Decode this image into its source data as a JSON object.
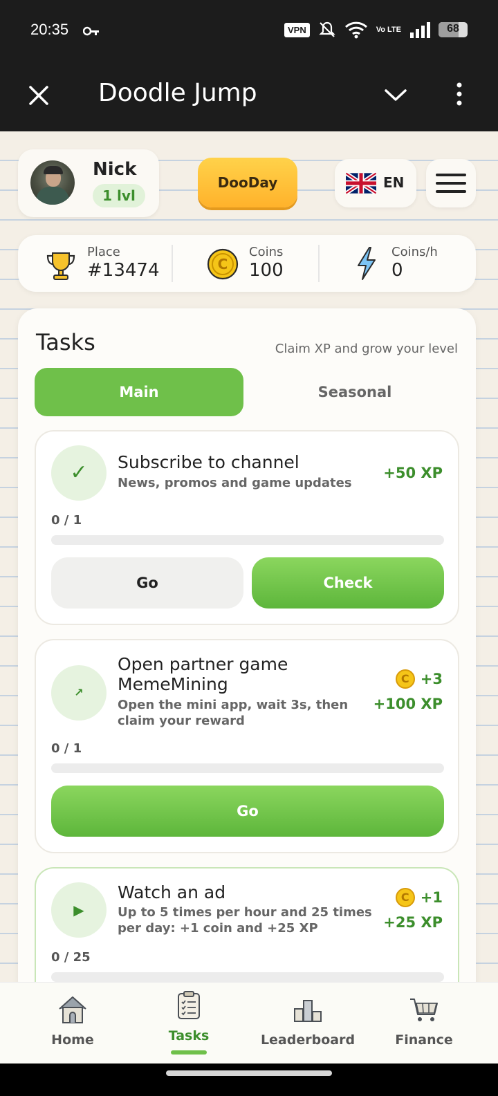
{
  "status_bar": {
    "time": "20:35",
    "vpn": "VPN",
    "network": "Vo LTE",
    "battery": "68",
    "battery_level": 0.68
  },
  "title_bar": {
    "title": "Doodle Jump"
  },
  "profile": {
    "name": "Nick",
    "level": "1 lvl"
  },
  "dooday_label": "DooDay",
  "language": "EN",
  "stats": {
    "place_label": "Place",
    "place_value": "#13474",
    "coins_label": "Coins",
    "coins_value": "100",
    "rate_label": "Coins/h",
    "rate_value": "0"
  },
  "tasks": {
    "title": "Tasks",
    "subtitle": "Claim XP and grow your level",
    "tabs": [
      "Main",
      "Seasonal"
    ],
    "items": [
      {
        "title": "Subscribe to channel",
        "description": "News, promos and game updates",
        "reward_xp": "+50 XP",
        "progress": "0 / 1",
        "progress_fraction": 0,
        "go_label": "Go",
        "check_label": "Check",
        "icon": "check-icon"
      },
      {
        "title": "Open partner game MemeMining",
        "description": "Open the mini app, wait 3s, then claim your reward",
        "reward_coins": "+3",
        "reward_xp": "+100 XP",
        "progress": "0 / 1",
        "progress_fraction": 0,
        "go_label": "Go",
        "icon": "external-arrow-icon"
      },
      {
        "title": "Watch an ad",
        "description": "Up to 5 times per hour and 25 times per day: +1 coin and +25 XP",
        "reward_coins": "+1",
        "reward_xp": "+25 XP",
        "progress": "0 / 25",
        "progress_fraction": 0,
        "icon": "play-icon"
      }
    ]
  },
  "nav": {
    "items": [
      "Home",
      "Tasks",
      "Leaderboard",
      "Finance"
    ],
    "active": "Tasks"
  },
  "colors": {
    "accent_green": "#6fc04a",
    "reward_green": "#3c8e2c",
    "dooday_yellow": "#ffc23a",
    "coin_gold": "#f5c518"
  }
}
